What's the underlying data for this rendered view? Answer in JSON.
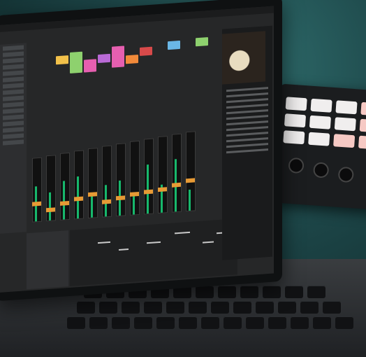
{
  "scene": {
    "subject": "laptop-daw-with-pad-controller",
    "colors": {
      "background": "#1c4446",
      "meter": "#17b86c",
      "fader_cap": "#e79a35",
      "clip_colors": [
        "#f2c14a",
        "#8ed16e",
        "#e65fb0",
        "#b96ad6",
        "#6ab7e6",
        "#f28a3a",
        "#d84a4a"
      ]
    },
    "icons": [
      "drum-photo-icon",
      "piano-roll-icon",
      "fader-icon",
      "pad-icon",
      "knob-icon"
    ]
  }
}
